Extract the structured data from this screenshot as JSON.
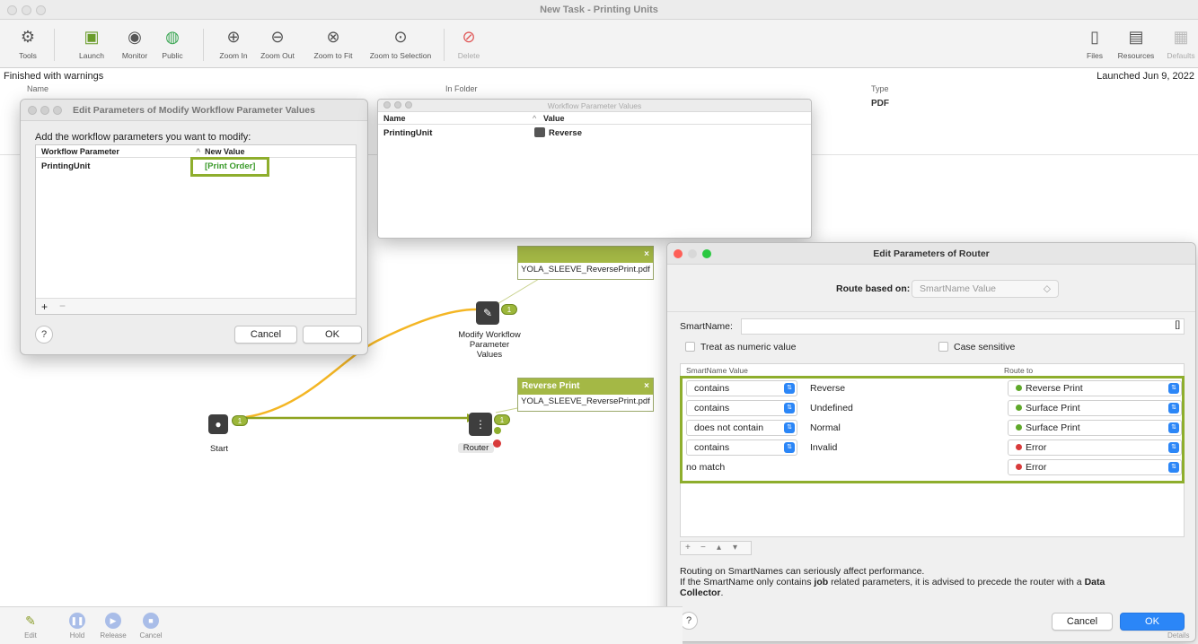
{
  "window": {
    "title": "New Task - Printing Units"
  },
  "toolbar": {
    "tools": "Tools",
    "launch": "Launch",
    "monitor": "Monitor",
    "public": "Public",
    "zoom_in": "Zoom In",
    "zoom_out": "Zoom Out",
    "zoom_to_fit": "Zoom to Fit",
    "zoom_to_selection": "Zoom to Selection",
    "delete": "Delete",
    "files": "Files",
    "resources": "Resources",
    "defaults": "Defaults"
  },
  "status": {
    "text": "Finished with warnings",
    "launched": "Launched Jun 9, 2022"
  },
  "columns": {
    "name": "Name",
    "in_folder": "In Folder",
    "type": "Type"
  },
  "row": {
    "type": "PDF"
  },
  "modify_dialog": {
    "title": "Edit Parameters of Modify Workflow Parameter Values",
    "prompt": "Add the workflow parameters you want to modify:",
    "col_param": "Workflow Parameter",
    "col_value": "New Value",
    "param": "PrintingUnit",
    "value": "[Print Order]",
    "cancel": "Cancel",
    "ok": "OK"
  },
  "wpv_window": {
    "title": "Workflow Parameter Values",
    "col_name": "Name",
    "col_value": "Value",
    "name": "PrintingUnit",
    "value": "Reverse"
  },
  "workflow": {
    "start_label": "Start",
    "modify_label": "Modify Workflow\nParameter\nValues",
    "router_label": "Router",
    "note1_file": "YOLA_SLEEVE_ReversePrint.pdf",
    "note2_title": "Reverse Print",
    "note2_file": "YOLA_SLEEVE_ReversePrint.pdf",
    "badge": "1"
  },
  "router_dialog": {
    "title": "Edit Parameters of Router",
    "route_based_on_label": "Route based on:",
    "route_based_on_value": "SmartName Value",
    "smartname_label": "SmartName:",
    "treat_numeric": "Treat as numeric value",
    "case_sensitive": "Case sensitive",
    "col_value": "SmartName Value",
    "col_route": "Route to",
    "rules": [
      {
        "op": "contains",
        "value": "Reverse",
        "route": "Reverse Print",
        "status": "green"
      },
      {
        "op": "contains",
        "value": "Undefined",
        "route": "Surface Print",
        "status": "green"
      },
      {
        "op": "does not contain",
        "value": "Normal",
        "route": "Surface Print",
        "status": "green"
      },
      {
        "op": "contains",
        "value": "Invalid",
        "route": "Error",
        "status": "red"
      }
    ],
    "no_match": "no match",
    "no_match_route": "Error",
    "note_line1": "Routing on SmartNames can seriously affect performance.",
    "note_line2a": "If the SmartName only contains ",
    "note_line2b": "job",
    "note_line2c": " related parameters, it is advised to precede the router with a ",
    "note_line2d": "Data",
    "note_line3": "Collector",
    "note_line3end": ".",
    "cancel": "Cancel",
    "ok": "OK"
  },
  "bottom": {
    "edit": "Edit",
    "hold": "Hold",
    "release": "Release",
    "cancel": "Cancel",
    "details": "Details"
  },
  "colors": {
    "accent_green": "#8eae2d",
    "blue": "#2b86f7",
    "route_green": "#5fa82a",
    "route_red": "#d83b3b"
  }
}
